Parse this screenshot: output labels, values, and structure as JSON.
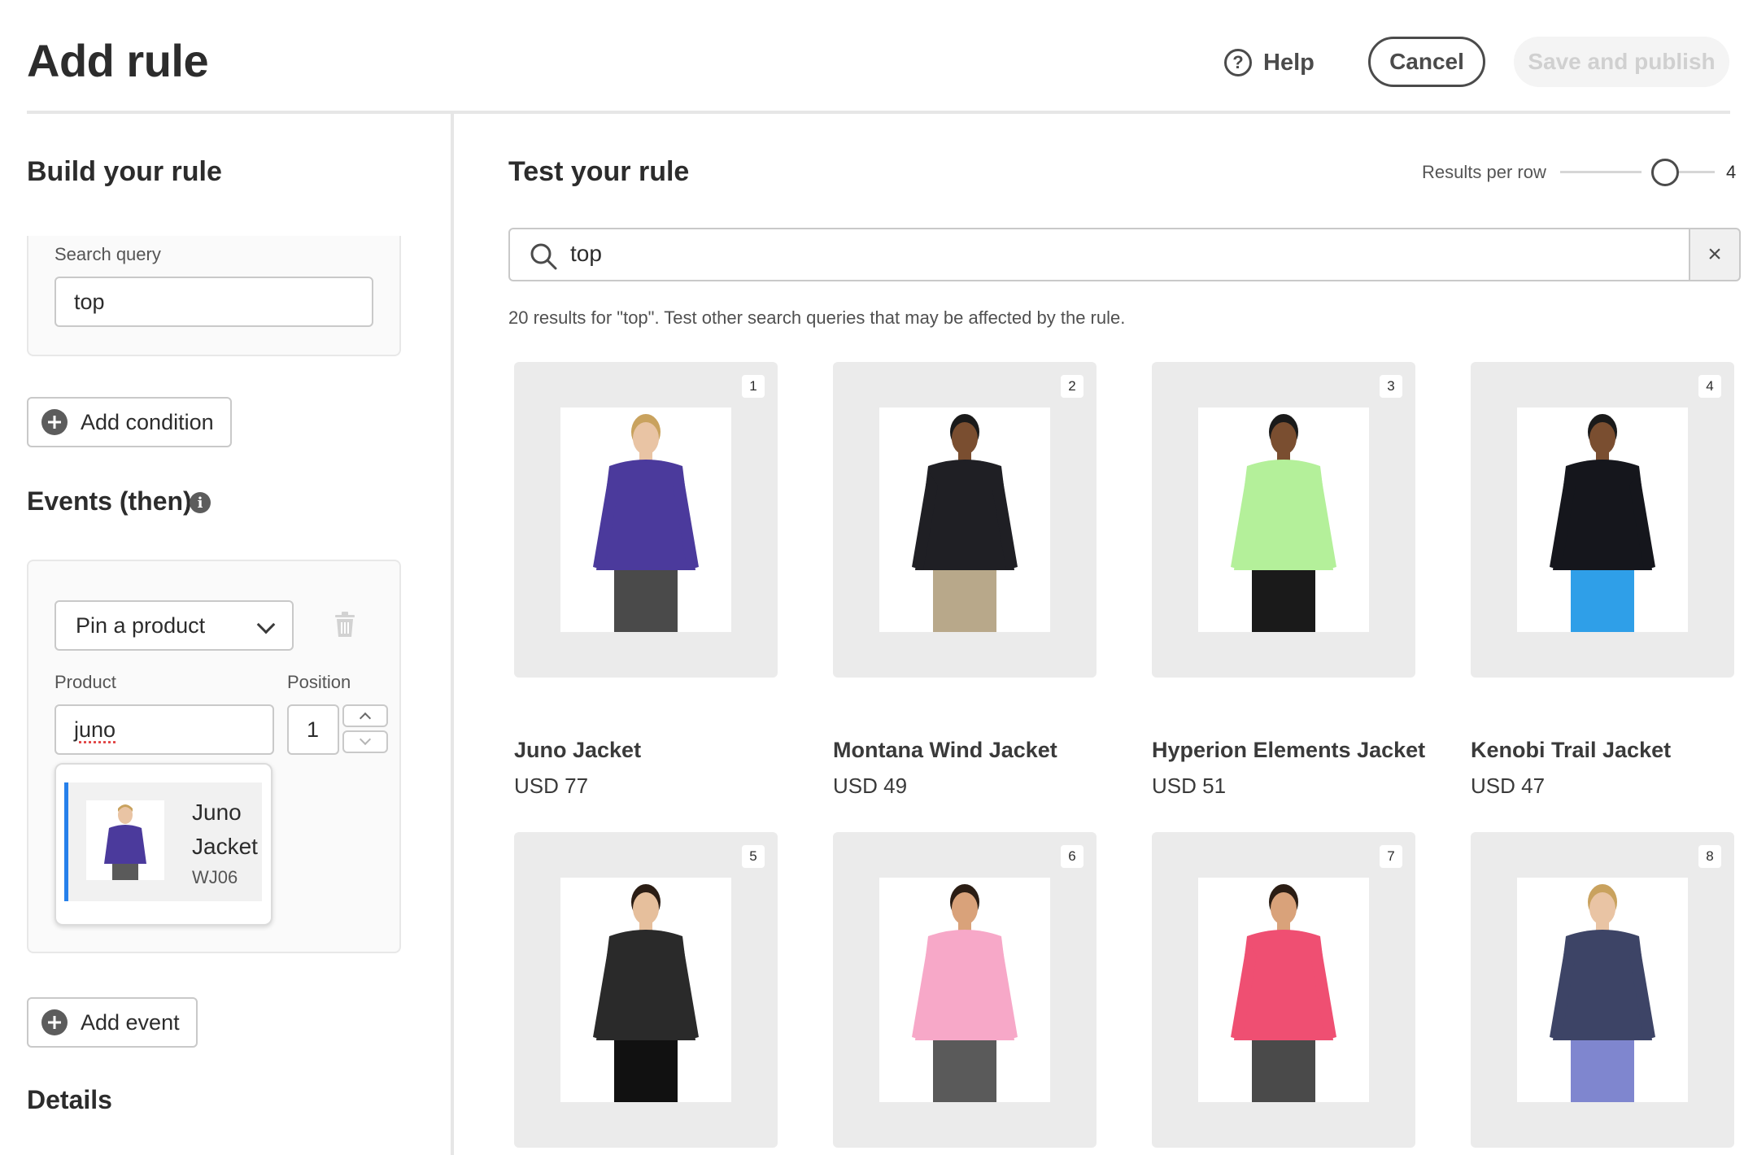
{
  "header": {
    "title": "Add rule",
    "help_label": "Help",
    "help_glyph": "?",
    "cancel_label": "Cancel",
    "publish_label": "Save and publish"
  },
  "build": {
    "heading": "Build your rule",
    "search_query_label": "Search query",
    "search_query_value": "top",
    "add_condition_label": "Add condition",
    "events_heading": "Events (then)",
    "info_glyph": "i",
    "event_select_value": "Pin a product",
    "product_label": "Product",
    "product_value": "juno",
    "position_label": "Position",
    "position_value": "1",
    "suggestion": {
      "name": "Juno Jacket",
      "sku": "WJ06",
      "colors": [
        "#4b3a9c",
        "#5a5a5a"
      ]
    },
    "add_event_label": "Add event",
    "details_heading": "Details"
  },
  "test": {
    "heading": "Test your rule",
    "results_per_row_label": "Results per row",
    "results_per_row_value": "4",
    "results_per_row_fraction": 0.68,
    "search_value": "top",
    "clear_glyph": "×",
    "summary": "20 results for \"top\". Test other search queries that may be affected by the rule.",
    "products": [
      {
        "rank": "1",
        "name": "Juno Jacket",
        "price": "USD 77",
        "top_color": "#4b3a9c",
        "bottom_color": "#4a4a4a",
        "skin": "#e9c4a4",
        "hair": "#c9a25e"
      },
      {
        "rank": "2",
        "name": "Montana Wind Jacket",
        "price": "USD 49",
        "top_color": "#1f1f24",
        "bottom_color": "#b8a88a",
        "skin": "#7a4e30",
        "hair": "#1a1a1a"
      },
      {
        "rank": "3",
        "name": "Hyperion Elements Jacket",
        "price": "USD 51",
        "top_color": "#b4f09a",
        "bottom_color": "#1a1a1a",
        "skin": "#7a4e30",
        "hair": "#1a1a1a"
      },
      {
        "rank": "4",
        "name": "Kenobi Trail Jacket",
        "price": "USD 47",
        "top_color": "#15161c",
        "bottom_color": "#2f9fe8",
        "skin": "#7a4e30",
        "hair": "#1a1a1a"
      },
      {
        "rank": "5",
        "name": "",
        "price": "",
        "top_color": "#2a2a2a",
        "bottom_color": "#111111",
        "skin": "#e6bf9c",
        "hair": "#2b1d14"
      },
      {
        "rank": "6",
        "name": "",
        "price": "",
        "top_color": "#f7a8c8",
        "bottom_color": "#5a5a5a",
        "skin": "#d9a27a",
        "hair": "#2b1d14"
      },
      {
        "rank": "7",
        "name": "",
        "price": "",
        "top_color": "#ef4f72",
        "bottom_color": "#4a4a4a",
        "skin": "#d9a27a",
        "hair": "#2b1d14"
      },
      {
        "rank": "8",
        "name": "",
        "price": "",
        "top_color": "#3d4466",
        "bottom_color": "#7f86cf",
        "skin": "#e9c4a4",
        "hair": "#c9a25e"
      }
    ]
  }
}
